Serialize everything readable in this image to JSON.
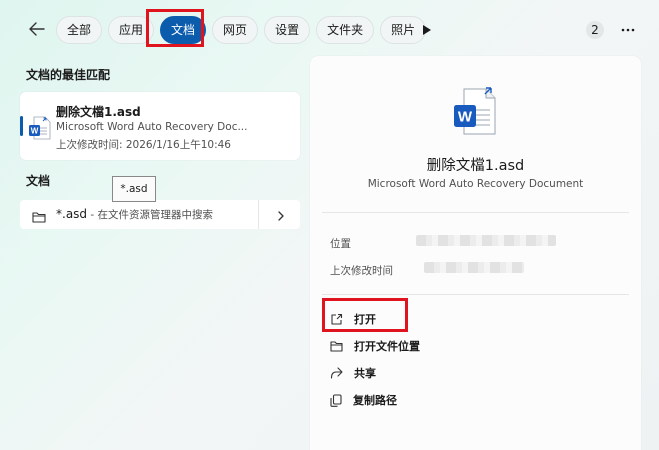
{
  "tabs": [
    {
      "label": "全部"
    },
    {
      "label": "应用"
    },
    {
      "label": "文档"
    },
    {
      "label": "网页"
    },
    {
      "label": "设置"
    },
    {
      "label": "文件夹"
    },
    {
      "label": "照片"
    }
  ],
  "active_tab": "文档",
  "result_count": "2",
  "best_match": {
    "section_title": "文档的最佳匹配",
    "name": "删除文檔1.asd",
    "description": "Microsoft Word Auto Recovery Doc...",
    "modified": "上次修改时间: 2026/1/16上午10:46"
  },
  "documents": {
    "section_title": "文档",
    "tooltip": "*.asd",
    "query": "*.asd",
    "query_hint": " - 在文件资源管理器中搜索"
  },
  "detail": {
    "title": "删除文檔1.asd",
    "subtitle": "Microsoft Word Auto Recovery Document",
    "location_label": "位置",
    "modified_label": "上次修改时间",
    "actions": [
      {
        "label": "打开",
        "icon": "open-external-icon"
      },
      {
        "label": "打开文件位置",
        "icon": "folder-icon"
      },
      {
        "label": "共享",
        "icon": "share-icon"
      },
      {
        "label": "复制路径",
        "icon": "copy-icon"
      }
    ]
  },
  "colors": {
    "accent": "#0b5cad",
    "highlight": "#e0141e",
    "word_blue": "#185abd"
  }
}
